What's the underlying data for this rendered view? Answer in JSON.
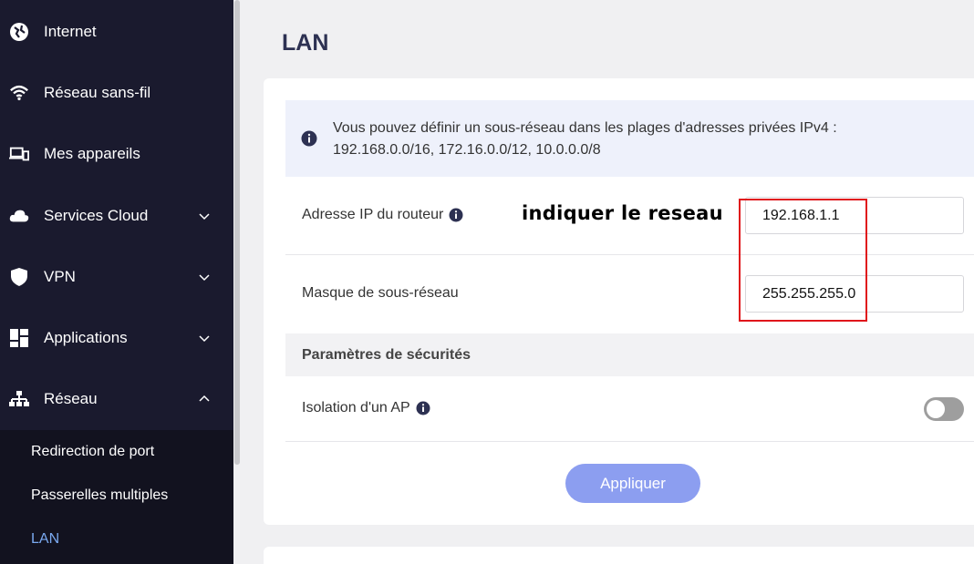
{
  "sidebar": {
    "items": [
      {
        "label": "Internet",
        "icon": "globe-icon"
      },
      {
        "label": "Réseau sans-fil",
        "icon": "wifi-icon"
      },
      {
        "label": "Mes appareils",
        "icon": "devices-icon"
      },
      {
        "label": "Services Cloud",
        "icon": "cloud-icon",
        "chevron": "chevron-down-icon"
      },
      {
        "label": "VPN",
        "icon": "shield-icon",
        "chevron": "chevron-down-icon"
      },
      {
        "label": "Applications",
        "icon": "apps-grid-icon",
        "chevron": "chevron-down-icon"
      },
      {
        "label": "Réseau",
        "icon": "network-icon",
        "chevron": "chevron-up-icon"
      }
    ],
    "submenu": [
      {
        "label": "Redirection de port"
      },
      {
        "label": "Passerelles multiples"
      },
      {
        "label": "LAN",
        "active": true
      }
    ]
  },
  "page": {
    "title": "LAN"
  },
  "info": {
    "line1": "Vous pouvez définir un sous-réseau dans les plages d'adresses privées IPv4 :",
    "line2": "192.168.0.0/16, 172.16.0.0/12, 10.0.0.0/8"
  },
  "form": {
    "router_ip_label": "Adresse IP du routeur",
    "router_ip_value": "192.168.1.1",
    "subnet_mask_label": "Masque de sous-réseau",
    "subnet_mask_value": "255.255.255.0",
    "security_section": "Paramètres de sécurités",
    "ap_isolation_label": "Isolation d'un AP",
    "ap_isolation_enabled": false,
    "apply_label": "Appliquer"
  },
  "annotation": {
    "text": "indiquer le reseau",
    "highlight_color": "#e0151b"
  },
  "colors": {
    "sidebar_bg": "#1a1a2e",
    "accent": "#8c9ef0",
    "active_link": "#7aa9f0",
    "title": "#2d3152"
  }
}
